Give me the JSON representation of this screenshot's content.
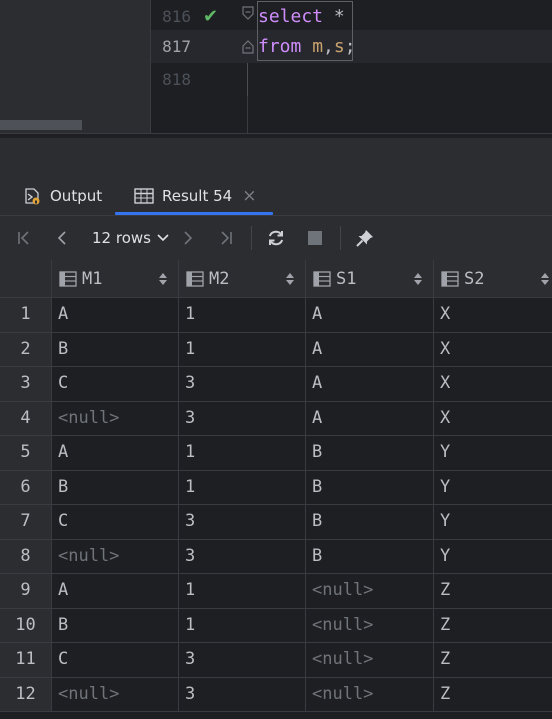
{
  "editor": {
    "lines": [
      {
        "num": "816",
        "tokens": [
          {
            "t": "select",
            "k": "kw"
          },
          {
            "t": " *",
            "k": "plain"
          }
        ],
        "status": "check"
      },
      {
        "num": "817",
        "tokens": [
          {
            "t": "from",
            "k": "kw"
          },
          {
            "t": " ",
            "k": "plain"
          },
          {
            "t": "m",
            "k": "ident"
          },
          {
            "t": ",",
            "k": "plain"
          },
          {
            "t": "s",
            "k": "ident"
          },
          {
            "t": ";",
            "k": "plain"
          }
        ]
      },
      {
        "num": "818",
        "tokens": []
      }
    ]
  },
  "tabs": [
    {
      "label": "Output",
      "icon": "output-icon"
    },
    {
      "label": "Result 54",
      "icon": "table-icon",
      "active": true,
      "closable": true
    }
  ],
  "tab_close_glyph": "×",
  "toolbar": {
    "rows_label": "12 rows",
    "buttons": [
      "first-page-icon",
      "previous-page-icon",
      "next-page-icon",
      "last-page-icon",
      "refresh-icon",
      "stop-icon",
      "pin-icon"
    ]
  },
  "grid": {
    "columns": [
      "M1",
      "M2",
      "S1",
      "S2"
    ],
    "rows": [
      {
        "n": "1",
        "cells": [
          "A",
          "1",
          "A",
          "X"
        ]
      },
      {
        "n": "2",
        "cells": [
          "B",
          "1",
          "A",
          "X"
        ]
      },
      {
        "n": "3",
        "cells": [
          "C",
          "3",
          "A",
          "X"
        ]
      },
      {
        "n": "4",
        "cells": [
          "<null>",
          "3",
          "A",
          "X"
        ]
      },
      {
        "n": "5",
        "cells": [
          "A",
          "1",
          "B",
          "Y"
        ]
      },
      {
        "n": "6",
        "cells": [
          "B",
          "1",
          "B",
          "Y"
        ]
      },
      {
        "n": "7",
        "cells": [
          "C",
          "3",
          "B",
          "Y"
        ]
      },
      {
        "n": "8",
        "cells": [
          "<null>",
          "3",
          "B",
          "Y"
        ]
      },
      {
        "n": "9",
        "cells": [
          "A",
          "1",
          "<null>",
          "Z"
        ]
      },
      {
        "n": "10",
        "cells": [
          "B",
          "1",
          "<null>",
          "Z"
        ]
      },
      {
        "n": "11",
        "cells": [
          "C",
          "3",
          "<null>",
          "Z"
        ]
      },
      {
        "n": "12",
        "cells": [
          "<null>",
          "3",
          "<null>",
          "Z"
        ]
      }
    ]
  },
  "colors": {
    "accent": "#3574f0",
    "keyword": "#cf8dfb",
    "identifier": "#c9a26d",
    "success": "#5fb865",
    "null_text": "#6f737a"
  }
}
